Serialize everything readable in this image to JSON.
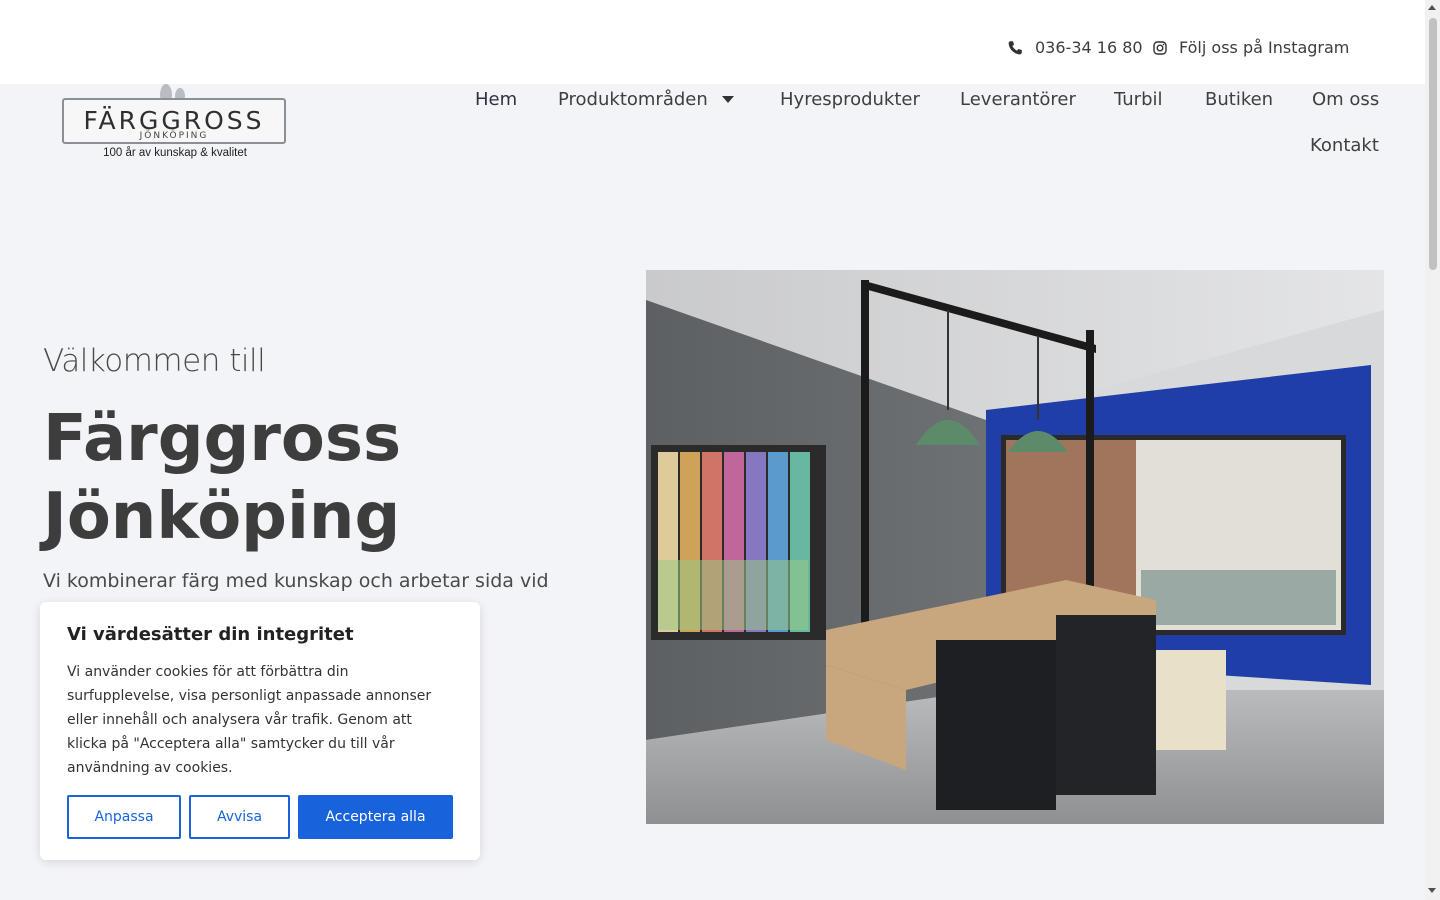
{
  "topbar": {
    "phone": "036-34 16 80",
    "instagram": "Följ oss på Instagram"
  },
  "logo": {
    "name": "FÄRGGROSS",
    "city": "JÖNKÖPING",
    "tagline": "100 år av kunskap & kvalitet"
  },
  "nav": {
    "items": [
      "Hem",
      "Produktområden",
      "Hyresprodukter",
      "Leverantörer",
      "Turbil",
      "Butiken",
      "Om oss",
      "Kontakt"
    ]
  },
  "hero": {
    "intro": "Välkommen till",
    "title_line1": "Färggross",
    "title_line2": "Jönköping",
    "subtitle": "Vi kombinerar färg med kunskap och arbetar sida vid"
  },
  "cookie": {
    "title": "Vi värdesätter din integritet",
    "text": "Vi använder cookies för att förbättra din surfupplevelse, visa personligt anpassade annonser eller innehåll och analysera vår trafik. Genom att klicka på \"Acceptera alla\" samtycker du till vår användning av cookies.",
    "customize": "Anpassa",
    "reject": "Avvisa",
    "accept": "Acceptera alla"
  },
  "colors": {
    "accent": "#1863dc",
    "page_bg": "#f3f4f8"
  }
}
